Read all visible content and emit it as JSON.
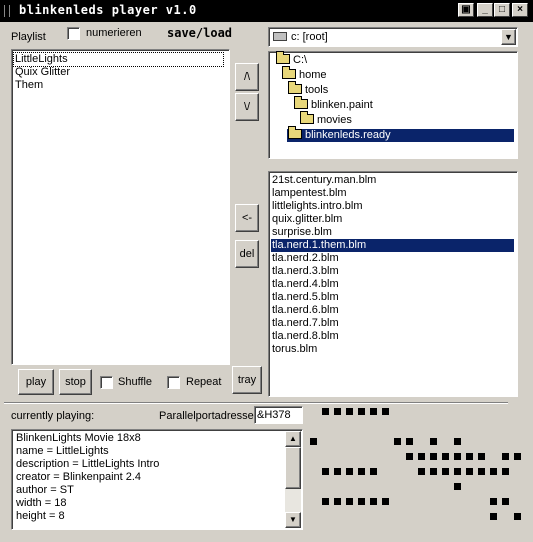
{
  "window": {
    "title": "blinkenleds player v1.0",
    "btn_min": "_",
    "btn_max": "□",
    "btn_close": "×"
  },
  "playlist": {
    "label": "Playlist",
    "numerieren_label": "numerieren",
    "save_load_label": "save/load",
    "items": [
      "LittleLights",
      "Quix Glitter",
      "Them"
    ]
  },
  "buttons": {
    "up": "/\\",
    "down": "\\/",
    "add": "<-",
    "del": "del",
    "play": "play",
    "stop": "stop",
    "tray": "tray"
  },
  "options": {
    "shuffle_label": "Shuffle",
    "repeat_label": "Repeat"
  },
  "drive": {
    "selected": "c: [root]"
  },
  "folders": [
    "C:\\",
    "home",
    "tools",
    "blinken.paint",
    "movies",
    "blinkenleds.ready"
  ],
  "files": [
    "21st.century.man.blm",
    "lampentest.blm",
    "littlelights.intro.blm",
    "quix.glitter.blm",
    "surprise.blm",
    "tla.nerd.1.them.blm",
    "tla.nerd.2.blm",
    "tla.nerd.3.blm",
    "tla.nerd.4.blm",
    "tla.nerd.5.blm",
    "tla.nerd.6.blm",
    "tla.nerd.7.blm",
    "tla.nerd.8.blm",
    "torus.blm"
  ],
  "status": {
    "currently_playing_label": "currently playing:",
    "parallelport_label": "Parallelportadresse:",
    "parallelport_value": "&H378"
  },
  "info": {
    "lines": [
      "BlinkenLights Movie 18x8",
      "name = LittleLights",
      "description = LittleLights Intro",
      "creator = Blinkenpaint 2.4",
      "author = ST",
      "width = 18",
      "height = 8"
    ]
  },
  "led_grid": {
    "rows": [
      "011111100000000000",
      "000000000000000000",
      "100000011010100000",
      "000000001111111011",
      "011111000111111110",
      "000000000000100000",
      "011111100000000110",
      "000000000000000101"
    ]
  },
  "colors": {
    "selection": "#0a246a",
    "face": "#d4d0c8"
  }
}
